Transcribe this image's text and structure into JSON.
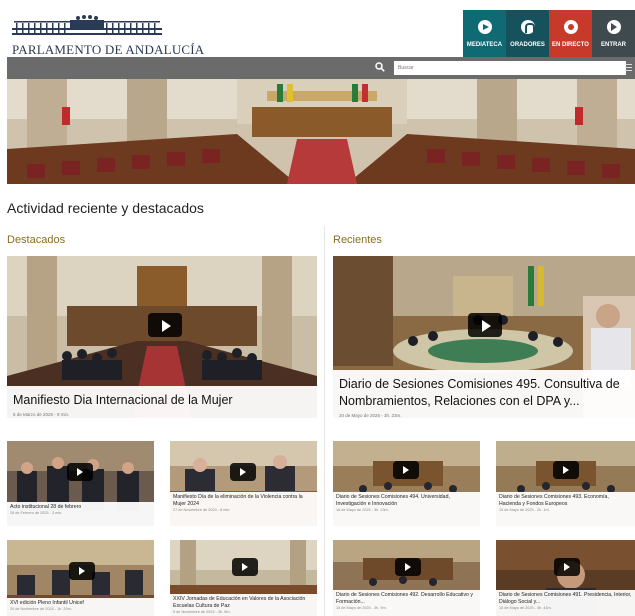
{
  "header": {
    "logo_text": "PARLAMENTO DE ANDALUCÍA",
    "nav": [
      {
        "label": "MEDIATECA",
        "icon": "play-icon"
      },
      {
        "label": "ORADORES",
        "icon": "user-icon"
      },
      {
        "label": "EN DIRECTO",
        "icon": "live-icon"
      },
      {
        "label": "ENTRAR",
        "icon": "enter-icon"
      }
    ]
  },
  "search": {
    "placeholder": "Buscar"
  },
  "section_title": "Actividad reciente y destacados",
  "destacados": {
    "title": "Destacados",
    "featured": {
      "title": "Manifiesto Dia Internacional de la Mujer",
      "meta": "5 de Marzo de 2025 - 9 min."
    },
    "items": [
      {
        "title": "Acto institucional 28 de febrero",
        "meta": "28 de Febrero de 2025 - 3 min."
      },
      {
        "title": "Manifiesto Día de la eliminación de la Violencia contra la Mujer 2024",
        "meta": "27 de Noviembre de 2024 - 6 min."
      },
      {
        "title": "XVI edición Pleno Infantil Unicef",
        "meta": "20 de Noviembre de 2024 - 1h. 20m."
      },
      {
        "title": "XXIV Jornadas de Educación en Valores de la Asociación Escuelas Cultura de Paz",
        "meta": "9 de Noviembre de 2024 - 3h. 5m."
      }
    ]
  },
  "recientes": {
    "title": "Recientes",
    "featured": {
      "title": "Diario de Sesiones Comisiones 495. Consultiva de Nombramientos, Relaciones con el DPA y...",
      "meta": "20 de Mayo de 2025 - 3h. 23m."
    },
    "items": [
      {
        "title": "Diario de Sesiones Comisiones 494. Universidad, Investigación e Innovación",
        "meta": "16 de Mayo de 2025 - 3h. 23m."
      },
      {
        "title": "Diario de Sesiones Comisiones 493. Economía, Hacienda y Fondos Europeos",
        "meta": "15 de Mayo de 2025 - 2h. 1m."
      },
      {
        "title": "Diario de Sesiones Comisiones 492. Desarrollo Educativo y Formación...",
        "meta": "15 de Mayo de 2025 - 3h. 9m."
      },
      {
        "title": "Diario de Sesiones Comisiones 491. Presidencia, Interior, Diálogo Social y...",
        "meta": "15 de Mayo de 2025 - 4h. 41m."
      }
    ]
  }
}
